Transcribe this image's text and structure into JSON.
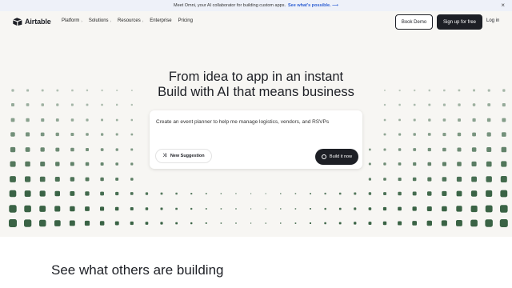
{
  "banner": {
    "text": "Meet Omni, your AI collaborator for building custom apps.",
    "link": "See what's possible. ⟶",
    "close_icon": "close-icon"
  },
  "nav": {
    "logo_text": "Airtable",
    "items": [
      {
        "label": "Platform",
        "dropdown": true
      },
      {
        "label": "Solutions",
        "dropdown": true
      },
      {
        "label": "Resources",
        "dropdown": true
      },
      {
        "label": "Enterprise",
        "dropdown": false
      },
      {
        "label": "Pricing",
        "dropdown": false
      }
    ],
    "book_demo": "Book Demo",
    "sign_up": "Sign up for free",
    "log_in": "Log in"
  },
  "hero": {
    "line1": "From idea to app in an instant",
    "line2": "Build with AI that means business",
    "prompt": "Create an event planner to help me manage logistics, vendors, and RSVPs",
    "suggestion": "New Suggestion",
    "build": "Build it now"
  },
  "section": {
    "title": "See what others are building"
  },
  "colors": {
    "hero_bg": "#f7f6f3",
    "dark": "#1d1f25",
    "dot_green": "#2f5b3b",
    "link_blue": "#2d5fd3"
  }
}
